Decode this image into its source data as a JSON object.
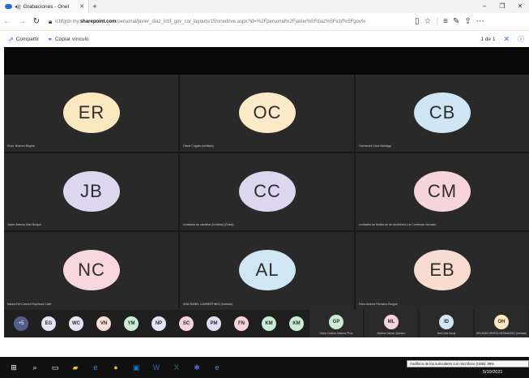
{
  "browser": {
    "tab_title": "Grabaciones - OneI",
    "tab_audio": "◂))",
    "url_prefix": "icbfgob-my.",
    "url_domain": "sharepoint.com",
    "url_rest": "/personal/javier_diaz_icbf_gov_co/_layouts/15/onedrive.aspx?id=%2Fpersonal%2Fjavier%5Fdiaz%5Ficbf%5Fgov%"
  },
  "commandbar": {
    "share_label": "Compartir",
    "copy_link_label": "Copiar vínculo",
    "page_count": "1 de 1"
  },
  "tiles": [
    {
      "initials": "ER",
      "name": "Ervin  Jimenez Begine",
      "color": "#f9e8c0"
    },
    {
      "initials": "OC",
      "name": "Oscar Cogollo (Invitado)",
      "color": "#fbe9c7"
    },
    {
      "initials": "CB",
      "name": "Carmenza Cano Barriaga",
      "color": "#cfe5f3"
    },
    {
      "initials": "JB",
      "name": "Javier Antonio Diaz Burgos",
      "color": "#dcd7ef"
    },
    {
      "initials": "CC",
      "name": "comisaria  de candelar (Invitado) (Guest)",
      "color": "#dcd7ef"
    },
    {
      "initials": "CM",
      "name": "comisaria de familia de  de candelaria Luz Contreras mercado",
      "color": "#f6d4dc"
    },
    {
      "initials": "NC",
      "name": "Nauira Del Carmen Espinosa Calle",
      "color": "#f7d6de"
    },
    {
      "initials": "AL",
      "name": "ANA ISABEL LUMBERTINEZ (Invitado)",
      "color": "#d0e6f2"
    },
    {
      "initials": "EB",
      "name": "Edna Andrea Pardomo Burgos",
      "color": "#f8dcd0"
    }
  ],
  "participants": [
    {
      "initials": "+5",
      "color": "#555d8a"
    },
    {
      "initials": "EG",
      "color": "#e7e3f4"
    },
    {
      "initials": "WC",
      "color": "#e7e3f4"
    },
    {
      "initials": "VN",
      "color": "#f6dfcf"
    },
    {
      "initials": "YM",
      "color": "#c9ecd2"
    },
    {
      "initials": "NP",
      "color": "#e2e7f7"
    },
    {
      "initials": "SC",
      "color": "#f6d4dc"
    },
    {
      "initials": "PM",
      "color": "#e3dff2"
    },
    {
      "initials": "FN",
      "color": "#f6d4dc"
    },
    {
      "initials": "KM",
      "color": "#c9ecd2"
    },
    {
      "initials": "KM",
      "color": "#c9ecd2"
    }
  ],
  "named_participants": [
    {
      "initials": "GP",
      "name": "Gloria Cristina Jimenez Pinto",
      "color": "#c9ecd2"
    },
    {
      "initials": "ML",
      "name": "Martina Galvan Quintero",
      "color": "#f6d4dc"
    },
    {
      "initials": "ID",
      "name": "Iselt Ortiz Doval",
      "color": "#d0e6f2"
    },
    {
      "initials": "OH",
      "name": "ORLANDO  ARISTA  HERNANDEZ (Invitado)",
      "color": "#f9e8c0"
    }
  ],
  "taskbar": {
    "tooltip": "Audífono de los auriculares con micrófono (USB): 89%",
    "date": "5/10/2021"
  }
}
